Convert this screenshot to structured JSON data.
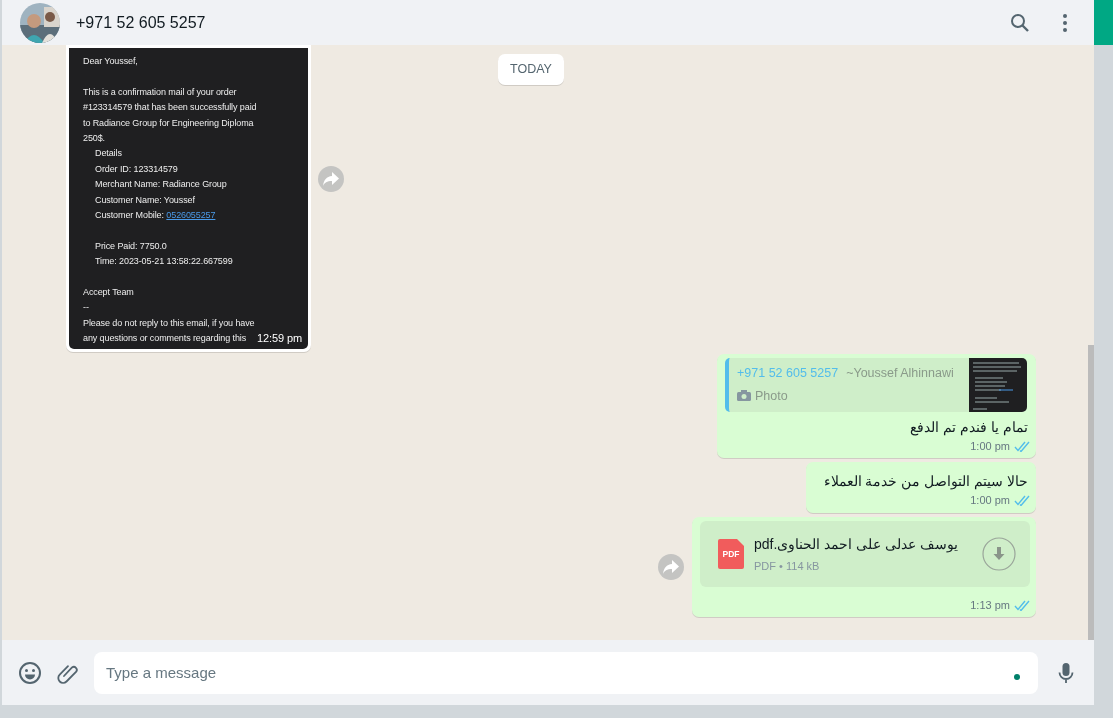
{
  "header": {
    "contact": "+971 52 605 5257"
  },
  "date_chip": "TODAY",
  "messages": [
    {
      "outgoing": false,
      "time": "12:59 pm",
      "paragraphs": [
        [
          {
            "text": "Dear Youssef,",
            "indented": false
          }
        ],
        [
          {
            "text": "This is a confirmation mail of your order",
            "indented": false
          },
          {
            "text": "#123314579 that has been successfully paid",
            "indented": false
          },
          {
            "text": "to  Radiance Group for Engineering Diploma",
            "indented": false
          },
          {
            "text": "250$.",
            "indented": false
          },
          {
            "text": "Details",
            "indented": true
          },
          {
            "text": "Order ID: 123314579",
            "indented": true
          },
          {
            "text": "Merchant Name: Radiance Group",
            "indented": true
          },
          {
            "text": "Customer Name: Youssef",
            "indented": true
          },
          {
            "text": "Customer Mobile:",
            "link": "0526055257",
            "indented": true
          }
        ],
        [
          {
            "text": "Price Paid: 7750.0",
            "indented": true
          },
          {
            "text": "Time: 2023-05-21 13:58:22.667599",
            "indented": true
          }
        ],
        [
          {
            "text": "Accept Team",
            "indented": false
          },
          {
            "text": "--",
            "indented": false
          },
          {
            "text": "Please do not reply to this email, if you have",
            "indented": false
          },
          {
            "text": "any questions or comments regarding this",
            "indented": false
          }
        ]
      ]
    },
    {
      "kind": "reply",
      "outgoing": true,
      "time": "1:00 pm",
      "read": true,
      "quote": {
        "author": "+971 52 605 5257",
        "name": "~Youssef Alhinnawi",
        "caption": "Photo"
      },
      "text": "تمام يا فندم تم الدفع"
    },
    {
      "kind": "text",
      "outgoing": true,
      "time": "1:00 pm",
      "read": true,
      "text": "حالا سيتم التواصل من خدمة العملاء"
    },
    {
      "kind": "document",
      "outgoing": true,
      "time": "1:13 pm",
      "read": true,
      "file_icon": "PDF",
      "file_name": "يوسف عدلى على احمد الحناوى.pdf",
      "file_info": "PDF • 114 kB"
    }
  ],
  "composer": {
    "placeholder": "Type a message"
  }
}
